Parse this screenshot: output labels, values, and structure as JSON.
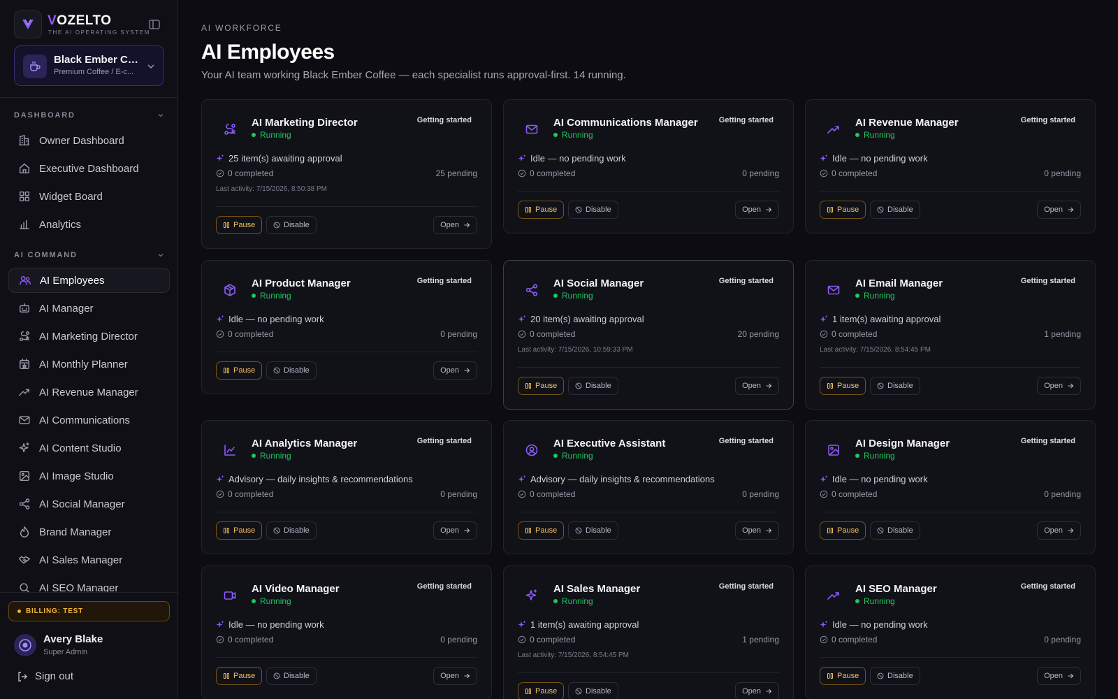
{
  "brand": {
    "name_first": "V",
    "name_rest": "OZELTO",
    "tagline": "THE AI OPERATING SYSTEM"
  },
  "workspace": {
    "name": "Black Ember Co...",
    "subtitle": "Premium Coffee / E-c..."
  },
  "sidebar": {
    "section_dashboard": "DASHBOARD",
    "section_ai_command": "AI COMMAND",
    "dashboard_items": [
      {
        "label": "Owner Dashboard",
        "icon": "building-icon"
      },
      {
        "label": "Executive Dashboard",
        "icon": "home-icon"
      },
      {
        "label": "Widget Board",
        "icon": "grid-icon"
      },
      {
        "label": "Analytics",
        "icon": "bar-chart-icon"
      }
    ],
    "command_items": [
      {
        "label": "AI Employees",
        "icon": "users-icon",
        "active": true
      },
      {
        "label": "AI Manager",
        "icon": "bot-icon"
      },
      {
        "label": "AI Marketing Director",
        "icon": "route-icon"
      },
      {
        "label": "AI Monthly Planner",
        "icon": "calendar-star-icon"
      },
      {
        "label": "AI Revenue Manager",
        "icon": "trending-up-icon"
      },
      {
        "label": "AI Communications",
        "icon": "mail-icon"
      },
      {
        "label": "AI Content Studio",
        "icon": "sparkles-icon"
      },
      {
        "label": "AI Image Studio",
        "icon": "image-icon"
      },
      {
        "label": "AI Social Manager",
        "icon": "share-icon"
      },
      {
        "label": "Brand Manager",
        "icon": "flame-icon"
      },
      {
        "label": "AI Sales Manager",
        "icon": "handshake-icon"
      },
      {
        "label": "AI SEO Manager",
        "icon": "search-icon"
      }
    ]
  },
  "billing": {
    "label": "BILLING: TEST"
  },
  "user": {
    "name": "Avery Blake",
    "role": "Super Admin"
  },
  "signout": {
    "label": "Sign out"
  },
  "header": {
    "eyebrow": "AI WORKFORCE",
    "title": "AI Employees",
    "subtitle": "Your AI team working Black Ember Coffee — each specialist runs approval-first. 14 running."
  },
  "cards": [
    {
      "title": "AI Marketing Director",
      "icon": "route-icon",
      "status": "Running",
      "badge": "Getting started",
      "line1": "25 item(s) awaiting approval",
      "completed": "0 completed",
      "pending": "25 pending",
      "activity": "Last activity: 7/15/2026, 8:50:38 PM",
      "pause": "Pause",
      "disable": "Disable",
      "open": "Open"
    },
    {
      "title": "AI Communications Manager",
      "icon": "mail-icon",
      "status": "Running",
      "badge": "Getting started",
      "line1": "Idle — no pending work",
      "completed": "0 completed",
      "pending": "0 pending",
      "activity": "",
      "pause": "Pause",
      "disable": "Disable",
      "open": "Open"
    },
    {
      "title": "AI Revenue Manager",
      "icon": "trending-up-icon",
      "status": "Running",
      "badge": "Getting started",
      "line1": "Idle — no pending work",
      "completed": "0 completed",
      "pending": "0 pending",
      "activity": "",
      "pause": "Pause",
      "disable": "Disable",
      "open": "Open"
    },
    {
      "title": "AI Product Manager",
      "icon": "package-icon",
      "status": "Running",
      "badge": "Getting started",
      "line1": "Idle — no pending work",
      "completed": "0 completed",
      "pending": "0 pending",
      "activity": "",
      "pause": "Pause",
      "disable": "Disable",
      "open": "Open"
    },
    {
      "title": "AI Social Manager",
      "icon": "share-icon",
      "status": "Running",
      "badge": "Getting started",
      "line1": "20 item(s) awaiting approval",
      "completed": "0 completed",
      "pending": "20 pending",
      "activity": "Last activity: 7/15/2026, 10:59:33 PM",
      "pause": "Pause",
      "disable": "Disable",
      "open": "Open"
    },
    {
      "title": "AI Email Manager",
      "icon": "mail-icon",
      "status": "Running",
      "badge": "Getting started",
      "line1": "1 item(s) awaiting approval",
      "completed": "0 completed",
      "pending": "1 pending",
      "activity": "Last activity: 7/15/2026, 8:54:45 PM",
      "pause": "Pause",
      "disable": "Disable",
      "open": "Open"
    },
    {
      "title": "AI Analytics Manager",
      "icon": "line-chart-icon",
      "status": "Running",
      "badge": "Getting started",
      "line1": "Advisory — daily insights & recommendations",
      "completed": "0 completed",
      "pending": "0 pending",
      "activity": "",
      "pause": "Pause",
      "disable": "Disable",
      "open": "Open"
    },
    {
      "title": "AI Executive Assistant",
      "icon": "user-circle-icon",
      "status": "Running",
      "badge": "Getting started",
      "line1": "Advisory — daily insights & recommendations",
      "completed": "0 completed",
      "pending": "0 pending",
      "activity": "",
      "pause": "Pause",
      "disable": "Disable",
      "open": "Open"
    },
    {
      "title": "AI Design Manager",
      "icon": "image-icon",
      "status": "Running",
      "badge": "Getting started",
      "line1": "Idle — no pending work",
      "completed": "0 completed",
      "pending": "0 pending",
      "activity": "",
      "pause": "Pause",
      "disable": "Disable",
      "open": "Open"
    },
    {
      "title": "AI Video Manager",
      "icon": "video-icon",
      "status": "Running",
      "badge": "Getting started",
      "line1": "Idle — no pending work",
      "completed": "0 completed",
      "pending": "0 pending",
      "activity": "",
      "pause": "Pause",
      "disable": "Disable",
      "open": "Open"
    },
    {
      "title": "AI Sales Manager",
      "icon": "sparkles-icon",
      "status": "Running",
      "badge": "Getting started",
      "line1": "1 item(s) awaiting approval",
      "completed": "0 completed",
      "pending": "1 pending",
      "activity": "Last activity: 7/15/2026, 8:54:45 PM",
      "pause": "Pause",
      "disable": "Disable",
      "open": "Open"
    },
    {
      "title": "AI SEO Manager",
      "icon": "trending-up-icon",
      "status": "Running",
      "badge": "Getting started",
      "line1": "Idle — no pending work",
      "completed": "0 completed",
      "pending": "0 pending",
      "activity": "",
      "pause": "Pause",
      "disable": "Disable",
      "open": "Open"
    }
  ],
  "colors": {
    "accent": "#8b5cf6",
    "running": "#22c55e",
    "pause": "#f3c061",
    "background": "#0c0c12"
  }
}
